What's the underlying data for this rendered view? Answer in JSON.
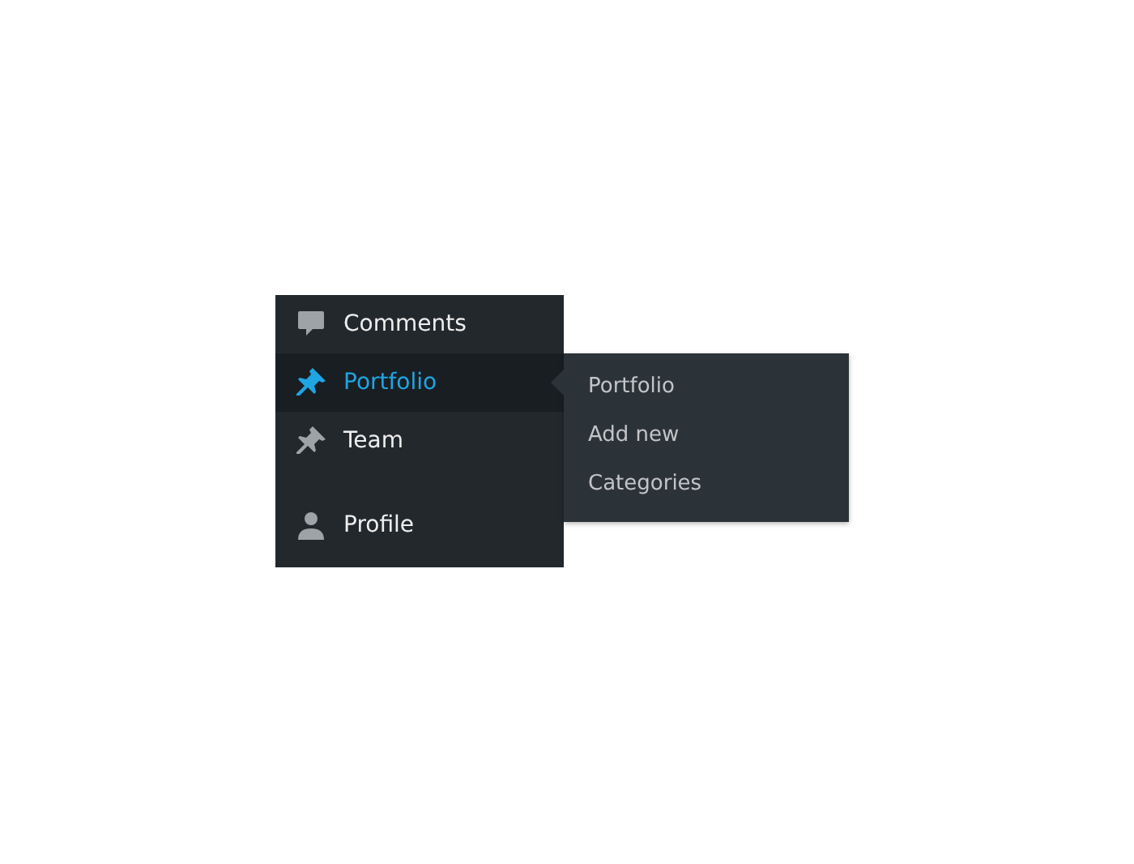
{
  "sidebar": {
    "items": [
      {
        "label": "Comments",
        "kind": "comment",
        "selected": false
      },
      {
        "label": "Portfolio",
        "kind": "pin",
        "selected": true,
        "submenu": [
          "Portfolio",
          "Add new",
          "Categories"
        ]
      },
      {
        "label": "Team",
        "kind": "pin",
        "selected": false
      },
      {
        "label": "Profile",
        "kind": "person",
        "selected": false
      }
    ]
  }
}
